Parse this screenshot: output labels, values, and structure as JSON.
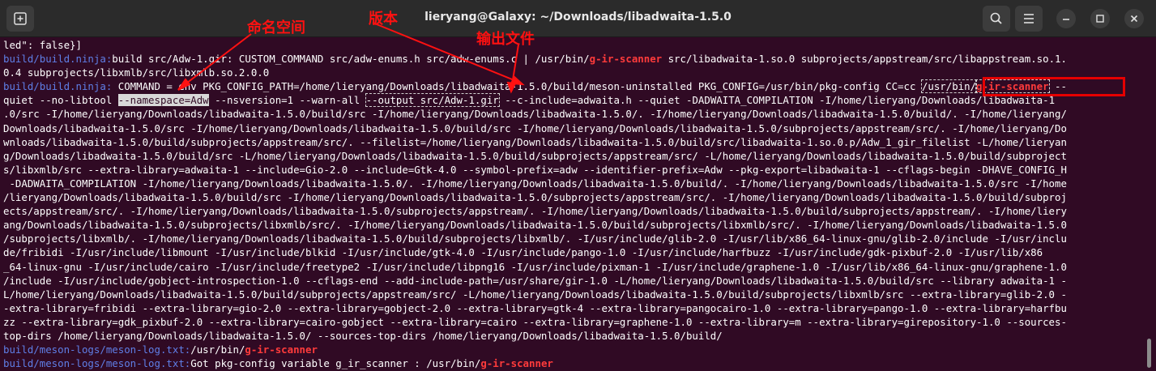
{
  "window": {
    "title": "lieryang@Galaxy: ~/Downloads/libadwaita-1.5.0",
    "icons": [
      "new-tab-icon",
      "search-icon",
      "menu-icon",
      "minimize-icon",
      "maximize-icon",
      "close-icon"
    ]
  },
  "annotations": {
    "namespace_label": "命名空间",
    "version_label": "版本",
    "output_label": "输出文件",
    "color": "#ff1111"
  },
  "colors": {
    "background": "#300a24",
    "prefix": "#5f7fe7",
    "highlight": "#ff3b3b"
  },
  "lines": [
    [
      {
        "t": "led\": false}]"
      }
    ],
    [
      {
        "t": "build/build.ninja:",
        "c": "pf"
      },
      {
        "t": "build src/Adw-1.gir: CUSTOM_COMMAND src/adw-enums.h src/adw-enums.c | /usr/bin/"
      },
      {
        "t": "g-ir-scanner",
        "c": "hl"
      },
      {
        "t": " src/libadwaita-1.so.0 subprojects/appstream/src/libappstream.so.1."
      }
    ],
    [
      {
        "t": "0.4 subprojects/libxmlb/src/libxmlb.so.2.0.0"
      }
    ],
    [
      {
        "t": "build/build.ninja:",
        "c": "pf"
      },
      {
        "t": " COMMAND = env PKG_CONFIG_PATH=/home/lieryang/Downloads/libadwaita-1.5.0/build/meson-uninstalled PKG_CONFIG=/usr/bin/pkg-config CC=cc "
      },
      {
        "t": "/usr/bin/",
        "c": "box"
      },
      {
        "t": "g-ir-scanner",
        "c": "hl box"
      },
      {
        "t": " --"
      }
    ],
    [
      {
        "t": "quiet --no-libtool "
      },
      {
        "t": "--namespace=Adw",
        "c": "sel"
      },
      {
        "t": " --nsversion=1 --warn-all "
      },
      {
        "t": "--output src/Adw-1.gir",
        "c": "box"
      },
      {
        "t": " --c-include=adwaita.h --quiet -DADWAITA_COMPILATION -I/home/lieryang/Downloads/libadwaita-1"
      }
    ],
    [
      {
        "t": ".0/src -I/home/lieryang/Downloads/libadwaita-1.5.0/build/src -I/home/lieryang/Downloads/libadwaita-1.5.0/. -I/home/lieryang/Downloads/libadwaita-1.5.0/build/. -I/home/lieryang/"
      }
    ],
    [
      {
        "t": "Downloads/libadwaita-1.5.0/src -I/home/lieryang/Downloads/libadwaita-1.5.0/build/src -I/home/lieryang/Downloads/libadwaita-1.5.0/subprojects/appstream/src/. -I/home/lieryang/Do"
      }
    ],
    [
      {
        "t": "wnloads/libadwaita-1.5.0/build/subprojects/appstream/src/. --filelist=/home/lieryang/Downloads/libadwaita-1.5.0/build/src/libadwaita-1.so.0.p/Adw_1_gir_filelist -L/home/lieryan"
      }
    ],
    [
      {
        "t": "g/Downloads/libadwaita-1.5.0/build/src -L/home/lieryang/Downloads/libadwaita-1.5.0/build/subprojects/appstream/src/ -L/home/lieryang/Downloads/libadwaita-1.5.0/build/subproject"
      }
    ],
    [
      {
        "t": "s/libxmlb/src --extra-library=adwaita-1 --include=Gio-2.0 --include=Gtk-4.0 --symbol-prefix=adw --identifier-prefix=Adw --pkg-export=libadwaita-1 --cflags-begin -DHAVE_CONFIG_H"
      }
    ],
    [
      {
        "t": " -DADWAITA_COMPILATION -I/home/lieryang/Downloads/libadwaita-1.5.0/. -I/home/lieryang/Downloads/libadwaita-1.5.0/build/. -I/home/lieryang/Downloads/libadwaita-1.5.0/src -I/home"
      }
    ],
    [
      {
        "t": "/lieryang/Downloads/libadwaita-1.5.0/build/src -I/home/lieryang/Downloads/libadwaita-1.5.0/subprojects/appstream/src/. -I/home/lieryang/Downloads/libadwaita-1.5.0/build/subproj"
      }
    ],
    [
      {
        "t": "ects/appstream/src/. -I/home/lieryang/Downloads/libadwaita-1.5.0/subprojects/appstream/. -I/home/lieryang/Downloads/libadwaita-1.5.0/build/subprojects/appstream/. -I/home/liery"
      }
    ],
    [
      {
        "t": "ang/Downloads/libadwaita-1.5.0/subprojects/libxmlb/src/. -I/home/lieryang/Downloads/libadwaita-1.5.0/build/subprojects/libxmlb/src/. -I/home/lieryang/Downloads/libadwaita-1.5.0"
      }
    ],
    [
      {
        "t": "/subprojects/libxmlb/. -I/home/lieryang/Downloads/libadwaita-1.5.0/build/subprojects/libxmlb/. -I/usr/include/glib-2.0 -I/usr/lib/x86_64-linux-gnu/glib-2.0/include -I/usr/inclu"
      }
    ],
    [
      {
        "t": "de/fribidi -I/usr/include/libmount -I/usr/include/blkid -I/usr/include/gtk-4.0 -I/usr/include/pango-1.0 -I/usr/include/harfbuzz -I/usr/include/gdk-pixbuf-2.0 -I/usr/lib/x86"
      }
    ],
    [
      {
        "t": "_64-linux-gnu -I/usr/include/cairo -I/usr/include/freetype2 -I/usr/include/libpng16 -I/usr/include/pixman-1 -I/usr/include/graphene-1.0 -I/usr/lib/x86_64-linux-gnu/graphene-1.0"
      }
    ],
    [
      {
        "t": "/include -I/usr/include/gobject-introspection-1.0 --cflags-end --add-include-path=/usr/share/gir-1.0 -L/home/lieryang/Downloads/libadwaita-1.5.0/build/src --library adwaita-1 -"
      }
    ],
    [
      {
        "t": "L/home/lieryang/Downloads/libadwaita-1.5.0/build/subprojects/appstream/src/ -L/home/lieryang/Downloads/libadwaita-1.5.0/build/subprojects/libxmlb/src --extra-library=glib-2.0 -"
      }
    ],
    [
      {
        "t": "-extra-library=fribidi --extra-library=gio-2.0 --extra-library=gobject-2.0 --extra-library=gtk-4 --extra-library=pangocairo-1.0 --extra-library=pango-1.0 --extra-library=harfbu"
      }
    ],
    [
      {
        "t": "zz --extra-library=gdk_pixbuf-2.0 --extra-library=cairo-gobject --extra-library=cairo --extra-library=graphene-1.0 --extra-library=m --extra-library=girepository-1.0 --sources-"
      }
    ],
    [
      {
        "t": "top-dirs /home/lieryang/Downloads/libadwaita-1.5.0/ --sources-top-dirs /home/lieryang/Downloads/libadwaita-1.5.0/build/"
      }
    ],
    [
      {
        "t": "build/meson-logs/meson-log.txt:",
        "c": "pf"
      },
      {
        "t": "/usr/bin/"
      },
      {
        "t": "g-ir-scanner",
        "c": "hl"
      }
    ],
    [
      {
        "t": "build/meson-logs/meson-log.txt:",
        "c": "pf"
      },
      {
        "t": "Got pkg-config variable g_ir_scanner : /usr/bin/"
      },
      {
        "t": "g-ir-scanner",
        "c": "hl"
      }
    ]
  ]
}
